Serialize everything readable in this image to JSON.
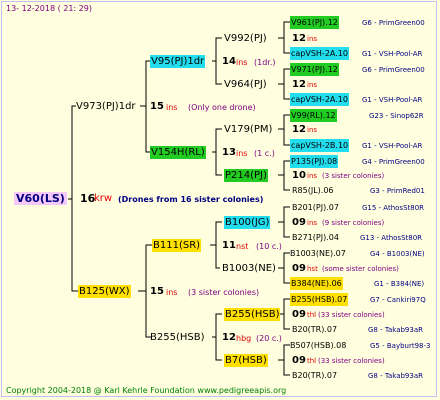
{
  "header": {
    "date": "13- 12-2018 ( 21: 29)"
  },
  "footer": {
    "copyright": "Copyright 2004-2018 @ Karl Kehrle Foundation   www.pedigreeapis.org"
  },
  "root": {
    "code": "V60(LS)",
    "num": "16",
    "unit": "krw",
    "note": "(Drones from 16 sister colonies)"
  },
  "gen1": [
    {
      "code": "V973(PJ)1dr",
      "num": "15",
      "unit": "ins",
      "note": "(Only one drone)"
    },
    {
      "code": "B125(WX)",
      "num": "15",
      "unit": "ins",
      "note": "(3 sister colonies)"
    }
  ],
  "gen2": [
    {
      "code": "V95(PJ)1dr",
      "num": "14",
      "unit": "ins",
      "note": "(1dr.)"
    },
    {
      "code": "V154H(RL)",
      "num": "13",
      "unit": "ins",
      "note": "(1 c.)"
    },
    {
      "code": "B111(SR)",
      "num": "11",
      "unit": "nst",
      "note": "(10 c.)"
    },
    {
      "code": "B255(HSB)",
      "num": "12",
      "unit": "hbg",
      "note": "(20 c.)"
    }
  ],
  "gen3": [
    {
      "code": "V992(PJ)"
    },
    {
      "code": "V964(PJ)"
    },
    {
      "code": "V179(PM)"
    },
    {
      "code": "P214(PJ)"
    },
    {
      "code": "B100(JG)"
    },
    {
      "code": "B1003(NE)"
    },
    {
      "code": "B255(HSB)"
    },
    {
      "code": "B7(HSB)"
    }
  ],
  "gen4": [
    {
      "code": "V961(PJ).12",
      "breeder": "G6 - PrimGreen00"
    },
    {
      "num": "12",
      "unit": "ins",
      "note": ""
    },
    {
      "code": "capVSH-2A.10",
      "breeder": "G1 - VSH-Pool-AR"
    },
    {
      "code": "V971(PJ).12",
      "breeder": "G6 - PrimGreen00"
    },
    {
      "num": "12",
      "unit": "ins",
      "note": ""
    },
    {
      "code": "capVSH-2A.10",
      "breeder": "G1 - VSH-Pool-AR"
    },
    {
      "code": "V99(RL).12",
      "breeder": "G23 - Sinop62R"
    },
    {
      "num": "12",
      "unit": "ins",
      "note": ""
    },
    {
      "code": "capVSH-2B.10",
      "breeder": "G1 - VSH-Pool-AR"
    },
    {
      "code": "P135(PJ).08",
      "breeder": "G4 - PrimGreen00"
    },
    {
      "num": "10",
      "unit": "ins",
      "note": "(3 sister colonies)"
    },
    {
      "code": "R85(JL).06",
      "breeder": "G3 - PrimRed01"
    },
    {
      "code": "B201(PJ).07",
      "breeder": "G15 - AthosSt80R"
    },
    {
      "num": "09",
      "unit": "ins",
      "note": "(9 sister colonies)"
    },
    {
      "code": "B271(PJ).04",
      "breeder": "G13 - AthosSt80R"
    },
    {
      "code": "B1003(NE).07",
      "breeder": "G4 - B1003(NE)"
    },
    {
      "num": "09",
      "unit": "hst",
      "note": "(some sister colonies)"
    },
    {
      "code": "B384(NE).06",
      "breeder": "G1 - B384(NE)"
    },
    {
      "code": "B255(HSB).07",
      "breeder": "G7 - Cankiri97Q"
    },
    {
      "num": "09",
      "unit": "thl",
      "note": "(33 sister colonies)"
    },
    {
      "code": "B20(TR).07",
      "breeder": "G8 - Takab93aR"
    },
    {
      "code": "B507(HSB).08",
      "breeder": "G5 - Bayburt98-3"
    },
    {
      "num": "09",
      "unit": "thl",
      "note": "(33 sister colonies)"
    },
    {
      "code": "B20(TR).07",
      "breeder": "G8 - Takab93aR"
    }
  ]
}
